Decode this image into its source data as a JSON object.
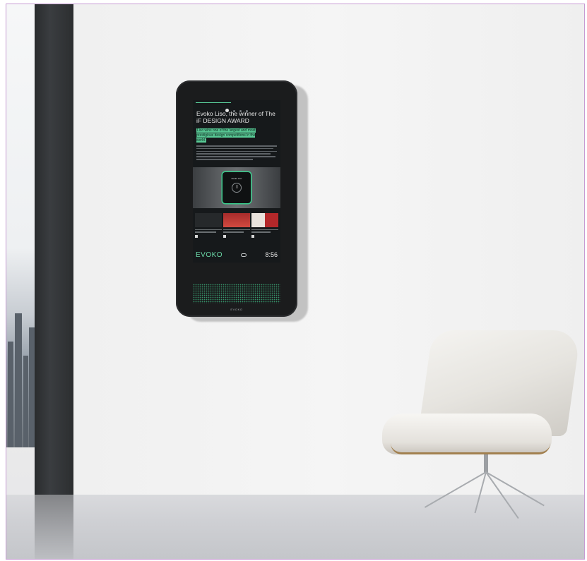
{
  "scene": {
    "description_tags": [
      "wall-mounted-display",
      "lounge-chair",
      "window",
      "pillar"
    ]
  },
  "device": {
    "screen": {
      "headline": "Evoko Liso, the winner of The iF DESIGN AWARD",
      "highlight": "Liso wins one of the largest and most prestigious design competitions in the world.",
      "promo_title": "Evoko Liso",
      "news_items": 3,
      "footer": {
        "logo": "EVOKO",
        "time": "8:56"
      }
    },
    "bottom_brand": "EVOKO"
  },
  "colors": {
    "accent": "#5cd6a0",
    "device_body": "#1b1c1d",
    "border": "#c79bd3"
  }
}
